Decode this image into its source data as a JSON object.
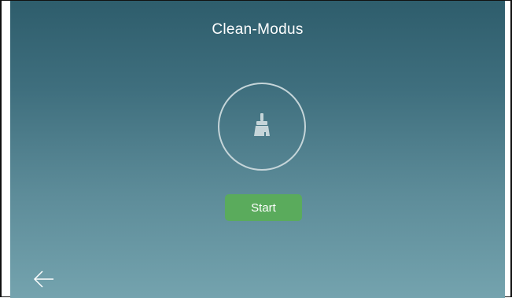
{
  "screen": {
    "title": "Clean-Modus",
    "background_top": "#2e5d6c",
    "background_bottom": "#74a3ae"
  },
  "mode": {
    "icon": "broom-icon",
    "icon_color": "#c5d5d9",
    "ring_color": "#c5d5d9"
  },
  "start": {
    "label": "Start",
    "color": "#5aab5c"
  },
  "navigation": {
    "back_icon": "arrow-left-icon"
  }
}
